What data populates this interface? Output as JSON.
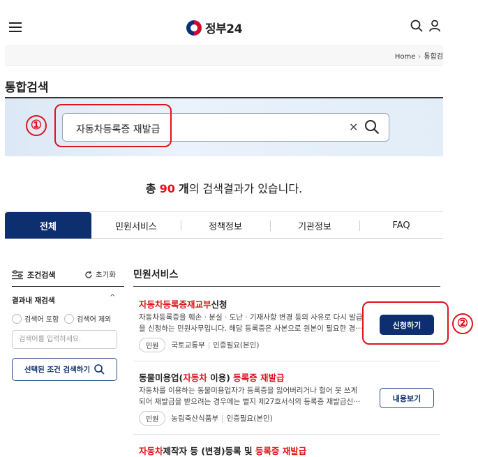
{
  "header": {
    "logo_text": "정부24",
    "menu_icon": "hamburger-menu-icon",
    "search_icon": "search-icon",
    "user_icon": "user-icon"
  },
  "breadcrumb": {
    "home": "Home",
    "current": "통합검"
  },
  "page_title": "통합검색",
  "search": {
    "value": "자동차등록증 재발급",
    "clear_label": "×"
  },
  "annotations": {
    "first": "①",
    "second": "②"
  },
  "summary": {
    "prefix": "총",
    "count": "90",
    "unit": "개",
    "suffix": "의 검색결과가 있습니다."
  },
  "tabs": [
    {
      "label": "전체",
      "active": true
    },
    {
      "label": "민원서비스",
      "active": false
    },
    {
      "label": "정책정보",
      "active": false
    },
    {
      "label": "기관정보",
      "active": false
    },
    {
      "label": "FAQ",
      "active": false
    }
  ],
  "filter": {
    "title": "조건검색",
    "reset": "초기화",
    "research_title": "결과내 재검색",
    "toggle": "^",
    "include": "검색어 포함",
    "exclude": "검색어 제외",
    "placeholder": "검색어를 입력하세요.",
    "apply": "선택된 조건 검색하기"
  },
  "results_section": {
    "title": "민원서비스",
    "items": [
      {
        "title_hl": "자동차등록증재교부",
        "title_rest": "신청",
        "desc1": "자동차등록증을 훼손 · 분실 · 도난 · 기재사항 변경 등의 사유로 다시 발급",
        "desc2": "을 신청하는 민원사무입니다. 해당 등록증은 사본으로 원본이 필요한 경···",
        "chip": "민원",
        "org": "국토교통부",
        "auth": "인증필요(본인)",
        "button": "신청하기"
      },
      {
        "title_a": "동물미용업(",
        "title_hl1": "자동차",
        "title_b": " 이용) ",
        "title_hl2": "등록증 재발급",
        "desc1": "자동차를 이용하는 동물미용업자가 등록증을 잃어버리거나 헐어 못 쓰게",
        "desc2": "되어 재발급을 받으려는 경우에는 별지 제27호서식의 등록증 재발급신···",
        "chip": "민원",
        "org": "농림축산식품부",
        "auth": "인증필요(본인)",
        "button": "내용보기"
      },
      {
        "title_hl1": "자동차",
        "title_a": "제작자 등 (변경)등록 및 ",
        "title_hl2": "등록증 재발급"
      }
    ]
  }
}
